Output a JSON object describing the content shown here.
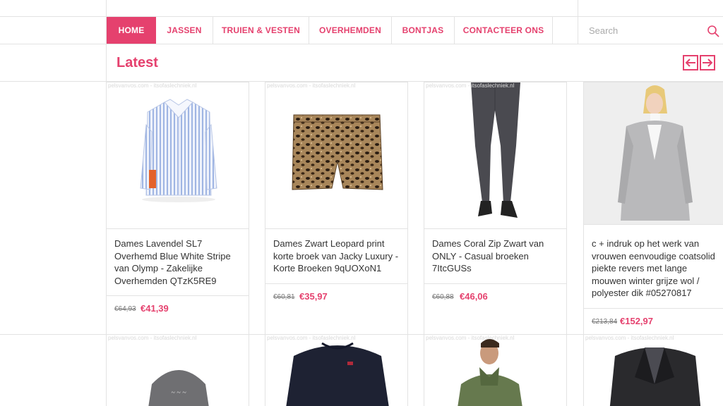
{
  "nav": {
    "items": [
      "HOME",
      "JASSEN",
      "TRUIEN & VESTEN",
      "OVERHEMDEN",
      "BONTJAS",
      "CONTACTEER ONS"
    ],
    "active_index": 0,
    "search_placeholder": "Search"
  },
  "section": {
    "title": "Latest",
    "prev_icon": "arrow-left-icon",
    "next_icon": "arrow-right-icon"
  },
  "watermark": "pelsvanvos.com - itsofaslechniek.nl",
  "products": [
    {
      "title": "Dames Lavendel SL7 Overhemd Blue White Stripe van Olymp - Zakelijke Overhemden QTzK5RE9",
      "old_price": "€64,93",
      "price": "€41,39",
      "image": "blue-striped-shirt"
    },
    {
      "title": "Dames Zwart Leopard print korte broek van Jacky Luxury - Korte Broeken 9qUOXoN1",
      "old_price": "€60,81",
      "price": "€35,97",
      "image": "leopard-shorts"
    },
    {
      "title": "Dames Coral Zip Zwart van ONLY - Casual broeken 7ItcGUSs",
      "old_price": "€60,88",
      "price": "€46,06",
      "image": "grey-jeans-legs"
    },
    {
      "title": "c + indruk op het werk van vrouwen eenvoudige coatsolid piekte revers met lange mouwen winter grijze wol / polyester dik #05270817",
      "old_price": "€213,84",
      "price": "€152,97",
      "image": "woman-grey-coat"
    }
  ],
  "row2": [
    {
      "image": "grey-hoodie"
    },
    {
      "image": "navy-sweater"
    },
    {
      "image": "man-green-jacket"
    },
    {
      "image": "black-blazer"
    }
  ],
  "colors": {
    "accent": "#e5416e",
    "border": "#e3e3e3"
  }
}
